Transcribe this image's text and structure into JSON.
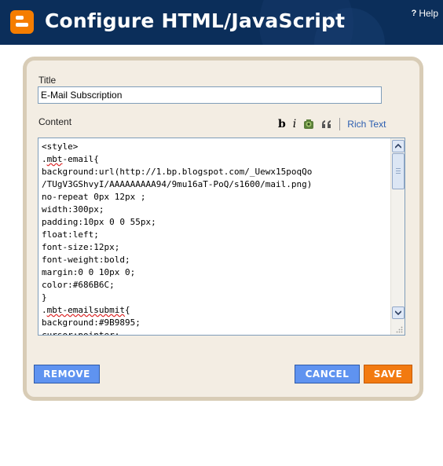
{
  "header": {
    "title": "Configure HTML/JavaScript",
    "help_label": "Help",
    "help_glyph": "?"
  },
  "form": {
    "title_label": "Title",
    "title_value": "E-Mail Subscription",
    "content_label": "Content",
    "toolbar": {
      "bold": "b",
      "italic": "i",
      "image_icon": "image-icon",
      "quote_icon": "quote-icon",
      "rich_text": "Rich Text"
    },
    "code_lines": [
      "<style>",
      ".mbt-email{",
      "background:url(http://1.bp.blogspot.com/_Uewx15poqQo",
      "/TUgV3GShvyI/AAAAAAAAA94/9mu16aT-PoQ/s1600/mail.png)",
      "no-repeat 0px 12px ;",
      "width:300px;",
      "padding:10px 0 0 55px;",
      "float:left;",
      "font-size:12px;",
      "font-weight:bold;",
      "margin:0 0 10px 0;",
      "color:#686B6C;",
      "}",
      ".mbt-emailsubmit{",
      "background:#9B9895;",
      "cursor:pointer;"
    ]
  },
  "buttons": {
    "remove": "REMOVE",
    "cancel": "CANCEL",
    "save": "SAVE"
  },
  "colors": {
    "header_bg": "#0b2e5a",
    "panel_bg": "#f3ede3",
    "panel_border": "#d8ccb6",
    "blue_button": "#5f93f0",
    "save_button": "#f27a10",
    "link": "#2a5db0"
  }
}
